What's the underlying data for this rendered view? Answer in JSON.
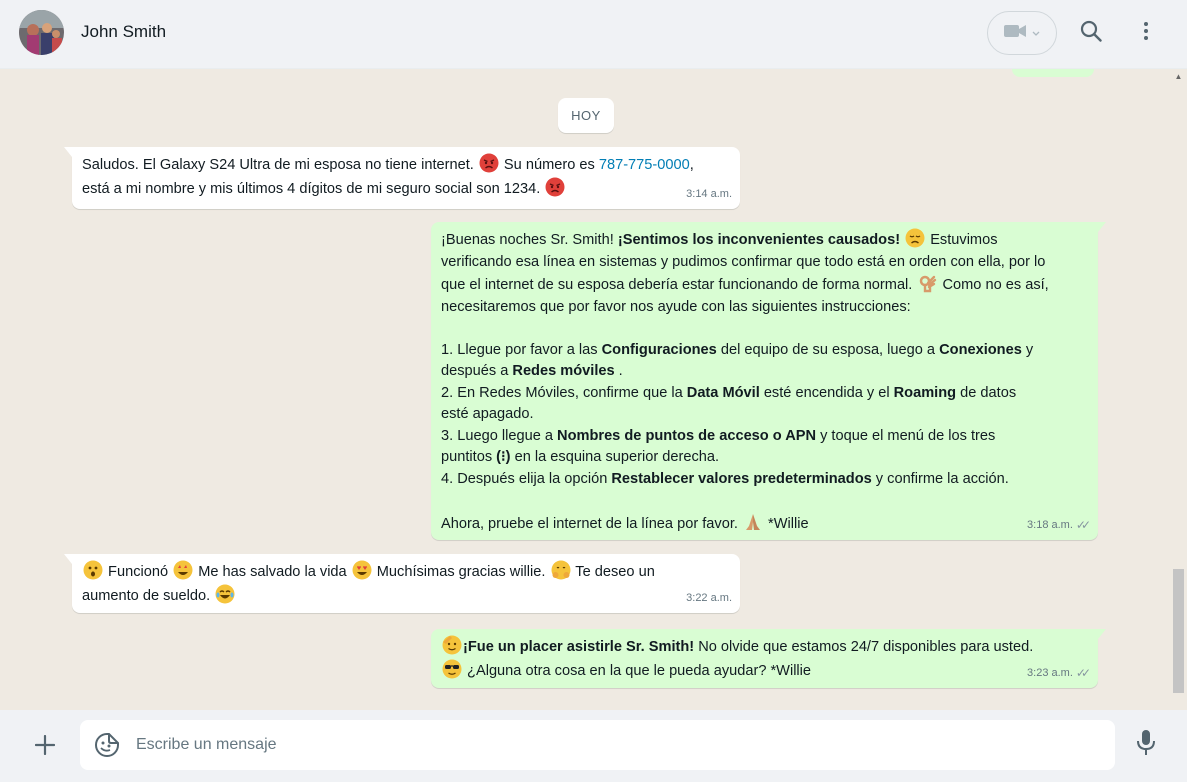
{
  "header": {
    "contact_name": "John Smith"
  },
  "chat": {
    "date_separator": "HOY",
    "messages": [
      {
        "direction": "in",
        "parts": {
          "t1": "Saludos. El Galaxy S24 Ultra de mi esposa no tiene internet. ",
          "t2": " Su número es ",
          "phone": "787-775-0000",
          "t3": ",",
          "t4": "está a mi nombre y mis últimos 4 dígitos de mi seguro social son 1234. "
        },
        "emojis": [
          "angry-face",
          "angry-face"
        ],
        "time": "3:14 a.m."
      },
      {
        "direction": "out",
        "parts": {
          "p1a": "¡Buenas noches Sr. Smith! ",
          "p1b": "¡Sentimos los inconvenientes causados!",
          "p1c": " Estuvimos",
          "p2": "verificando esa línea en sistemas y pudimos confirmar que todo está en orden con ella, por lo",
          "p3": "que el internet de su esposa debería estar funcionando de forma normal. ",
          "p3b": " Como no es así,",
          "p4": "necesitaremos que por favor nos ayude con las siguientes instrucciones:",
          "s1a": "1.     Llegue por favor a las ",
          "s1b": "Configuraciones",
          "s1c": " del equipo de su esposa, luego a ",
          "s1d": "Conexiones",
          "s1e": " y",
          "s1f": "después a ",
          "s1g": "Redes móviles",
          "s1h": " .",
          "s2a": "2.     En Redes Móviles, confirme que la ",
          "s2b": "Data Móvil",
          "s2c": " esté encendida y el ",
          "s2d": "Roaming",
          "s2e": " de datos",
          "s2f": "esté apagado.",
          "s3a": "3.     Luego llegue a ",
          "s3b": "Nombres de puntos de acceso o APN",
          "s3c": "   y toque el menú de los tres",
          "s3d": "puntitos ",
          "s3e": "(⁝)",
          "s3f": " en la esquina superior derecha.",
          "s4a": "4.     Después elija la opción ",
          "s4b": "Restablecer valores predeterminados",
          "s4c": " y confirme la acción.",
          "last": "Ahora, pruebe el internet de la línea por favor. ",
          "sign": " *Willie"
        },
        "emojis": [
          "disappointed-face",
          "ok-hand",
          "folded-hands"
        ],
        "time": "3:18 a.m."
      },
      {
        "direction": "in",
        "parts": {
          "t1": " Funcionó ",
          "t2": " Me has salvado la vida ",
          "t3": " Muchísimas gracias willie. ",
          "t4": " Te deseo un",
          "t5": "aumento de sueldo. "
        },
        "emojis": [
          "astonished-face",
          "star-struck-face",
          "heart-eyes-face",
          "hugging-face",
          "tears-of-joy-face"
        ],
        "time": "3:22 a.m."
      },
      {
        "direction": "out",
        "parts": {
          "t1b": "¡Fue un placer asistirle Sr. Smith!",
          "t1c": " No olvide que estamos 24/7 disponibles para usted.",
          "t2": " ¿Alguna otra cosa en la que le pueda ayudar? *Willie"
        },
        "emojis": [
          "saluting-face",
          "sunglasses-face"
        ],
        "time": "3:23 a.m."
      }
    ]
  },
  "composer": {
    "placeholder": "Escribe un mensaje"
  },
  "colors": {
    "outgoing_bubble": "#d9fdd3",
    "incoming_bubble": "#ffffff",
    "chat_background": "#efeae2",
    "header_background": "#f0f2f5",
    "link": "#027eb5"
  }
}
